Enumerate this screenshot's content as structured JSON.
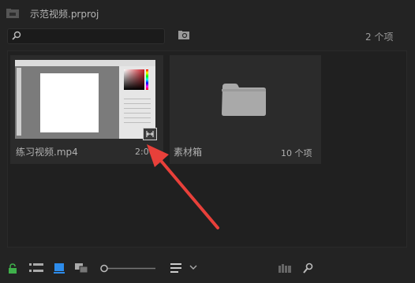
{
  "header": {
    "title": "示范视频.prproj"
  },
  "search": {
    "placeholder": "",
    "item_count": "2 个项"
  },
  "items": [
    {
      "name": "练习视频.mp4",
      "duration": "2:00",
      "type": "clip"
    },
    {
      "name": "素材箱",
      "count": "10 个项",
      "type": "bin"
    }
  ],
  "colors": {
    "accent_blue": "#2d8ceb",
    "lock_green": "#3fb04b",
    "arrow_red": "#e8403a"
  },
  "toolbar": {
    "icons": [
      "lock-icon",
      "list-view-icon",
      "icon-view-icon",
      "freeform-view-icon",
      "zoom-slider",
      "sort-icon",
      "sort-dropdown-icon",
      "automate-icon",
      "find-icon"
    ]
  }
}
